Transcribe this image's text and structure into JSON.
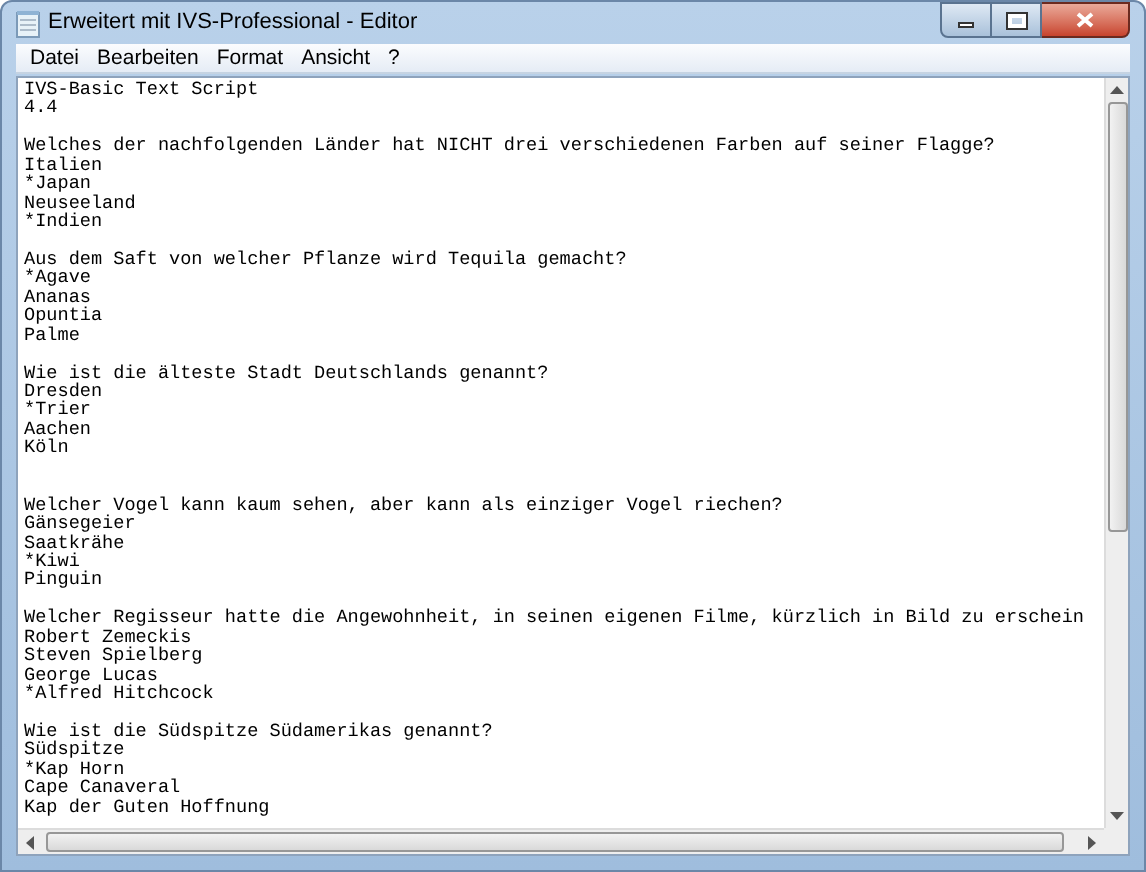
{
  "window": {
    "title": "Erweitert mit IVS-Professional - Editor"
  },
  "menu": [
    "Datei",
    "Bearbeiten",
    "Format",
    "Ansicht",
    "?"
  ],
  "editor": {
    "lines": [
      {
        "kind": "text",
        "text": "IVS-Basic Text Script"
      },
      {
        "kind": "text",
        "text": "4.4"
      },
      {
        "kind": "blank"
      },
      {
        "kind": "text",
        "text": "Welches der nachfolgenden Länder hat NICHT drei verschiedenen Farben auf seiner Flagge?"
      },
      {
        "kind": "text",
        "text": "Italien"
      },
      {
        "kind": "text",
        "text": "*Japan"
      },
      {
        "kind": "text",
        "text": "Neuseeland"
      },
      {
        "kind": "text",
        "text": "*Indien"
      },
      {
        "kind": "blank"
      },
      {
        "kind": "text",
        "text": "Aus dem Saft von welcher Pflanze wird Tequila gemacht?"
      },
      {
        "kind": "text",
        "text": "*Agave"
      },
      {
        "kind": "text",
        "text": "Ananas"
      },
      {
        "kind": "text",
        "text": "Opuntia"
      },
      {
        "kind": "text",
        "text": "Palme"
      },
      {
        "kind": "blank"
      },
      {
        "kind": "text",
        "text": "Wie ist die älteste Stadt Deutschlands genannt?"
      },
      {
        "kind": "text",
        "text": "Dresden"
      },
      {
        "kind": "text",
        "text": "*Trier"
      },
      {
        "kind": "text",
        "text": "Aachen"
      },
      {
        "kind": "text",
        "text": "Köln"
      },
      {
        "kind": "blank"
      },
      {
        "kind": "blank"
      },
      {
        "kind": "text",
        "text": "Welcher Vogel kann kaum sehen, aber kann als einziger Vogel riechen?"
      },
      {
        "kind": "text",
        "text": "Gänsegeier"
      },
      {
        "kind": "text",
        "text": "Saatkrähe"
      },
      {
        "kind": "text",
        "text": "*Kiwi"
      },
      {
        "kind": "text",
        "text": "Pinguin"
      },
      {
        "kind": "blank"
      },
      {
        "kind": "text",
        "text": "Welcher Regisseur hatte die Angewohnheit, in seinen eigenen Filme, kürzlich in Bild zu erschein"
      },
      {
        "kind": "text",
        "text": "Robert Zemeckis"
      },
      {
        "kind": "text",
        "text": "Steven Spielberg"
      },
      {
        "kind": "text",
        "text": "George Lucas"
      },
      {
        "kind": "text",
        "text": "*Alfred Hitchcock"
      },
      {
        "kind": "blank"
      },
      {
        "kind": "text",
        "text": "Wie ist die Südspitze Südamerikas genannt?"
      },
      {
        "kind": "text",
        "text": "Südspitze"
      },
      {
        "kind": "text",
        "text": "*Kap Horn"
      },
      {
        "kind": "text",
        "text": "Cape Canaveral"
      },
      {
        "kind": "text",
        "text": "Kap der Guten Hoffnung"
      }
    ]
  }
}
